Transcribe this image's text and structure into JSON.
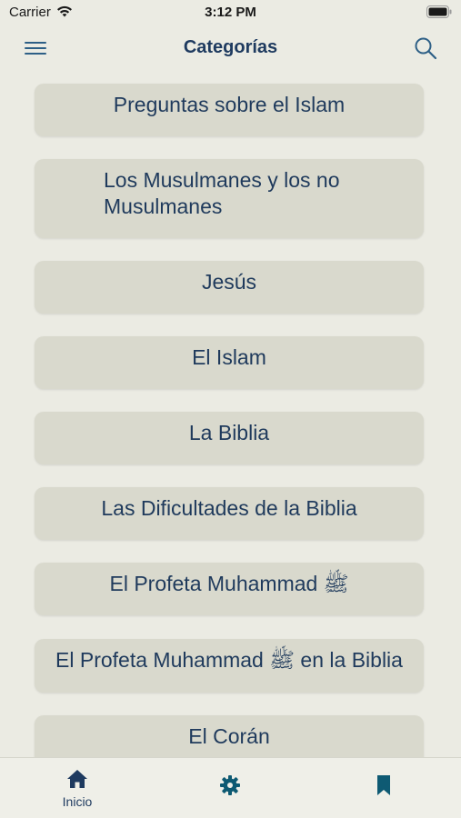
{
  "status_bar": {
    "carrier": "Carrier",
    "time": "3:12 PM",
    "wifi_icon": "wifi-icon",
    "battery_icon": "battery-icon"
  },
  "nav": {
    "title": "Categorías",
    "menu_icon": "hamburger-menu-icon",
    "search_icon": "search-icon"
  },
  "categories": [
    {
      "label": "Preguntas sobre el Islam"
    },
    {
      "label": "Los Musulmanes y los no Musulmanes"
    },
    {
      "label": "Jesús"
    },
    {
      "label": "El Islam"
    },
    {
      "label": "La Biblia"
    },
    {
      "label": "Las Dificultades de la Biblia"
    },
    {
      "label": "El Profeta Muhammad ﷺ"
    },
    {
      "label": "El Profeta Muhammad ﷺ en la Biblia"
    },
    {
      "label": "El Corán"
    }
  ],
  "tabbar": {
    "home_label": "Inicio",
    "home_icon": "home-icon",
    "settings_icon": "gear-icon",
    "bookmarks_icon": "bookmark-icon"
  },
  "colors": {
    "background": "#ebebe3",
    "card": "#d9d9cd",
    "text_primary": "#1f3a5c",
    "accent_icon": "#0e5a73",
    "tab_active": "#1e3a5f"
  }
}
